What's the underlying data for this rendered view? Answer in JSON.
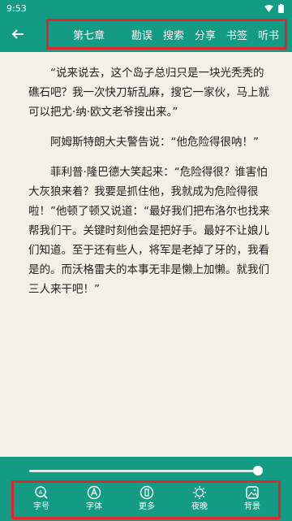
{
  "status_bar": {
    "time": "9:53"
  },
  "header": {
    "chapter": "第七章",
    "actions": [
      "勘误",
      "搜索",
      "分享",
      "书签",
      "听书"
    ]
  },
  "reader": {
    "paragraphs": [
      "“说来说去，这个岛子总归只是一块光秃秃的礁石吧？我一次快刀斩乱麻，搜它一家伙，马上就可以把尤·纳·欧文老爷搜出来。”",
      "阿姆斯特朗大夫警告说：“他危险得很呐！”",
      "菲利普·隆巴德大笑起来：“危险得很？谁害怕大灰狼来着？我要是抓住他，我就成为危险得很啦！”他顿了顿又说道：“最好我们把布洛尔也找来帮我们干。关键时刻他会是把好手。最好不让娘儿们知道。至于还有些人，将军是老掉了牙的，我看是的。而沃格雷夫的本事无非是懒上加懒。就我们三人来干吧！”"
    ],
    "progress": 1.0
  },
  "toolbar": {
    "items": [
      {
        "label": "字号",
        "icon": "font-size-icon"
      },
      {
        "label": "字体",
        "icon": "font-icon"
      },
      {
        "label": "更多",
        "icon": "more-icon"
      },
      {
        "label": "夜晚",
        "icon": "night-mode-icon"
      },
      {
        "label": "背景",
        "icon": "background-icon"
      }
    ]
  },
  "colors": {
    "primary": "#139c83",
    "page_bg": "#f3f0e6",
    "highlight": "#e0262b"
  }
}
